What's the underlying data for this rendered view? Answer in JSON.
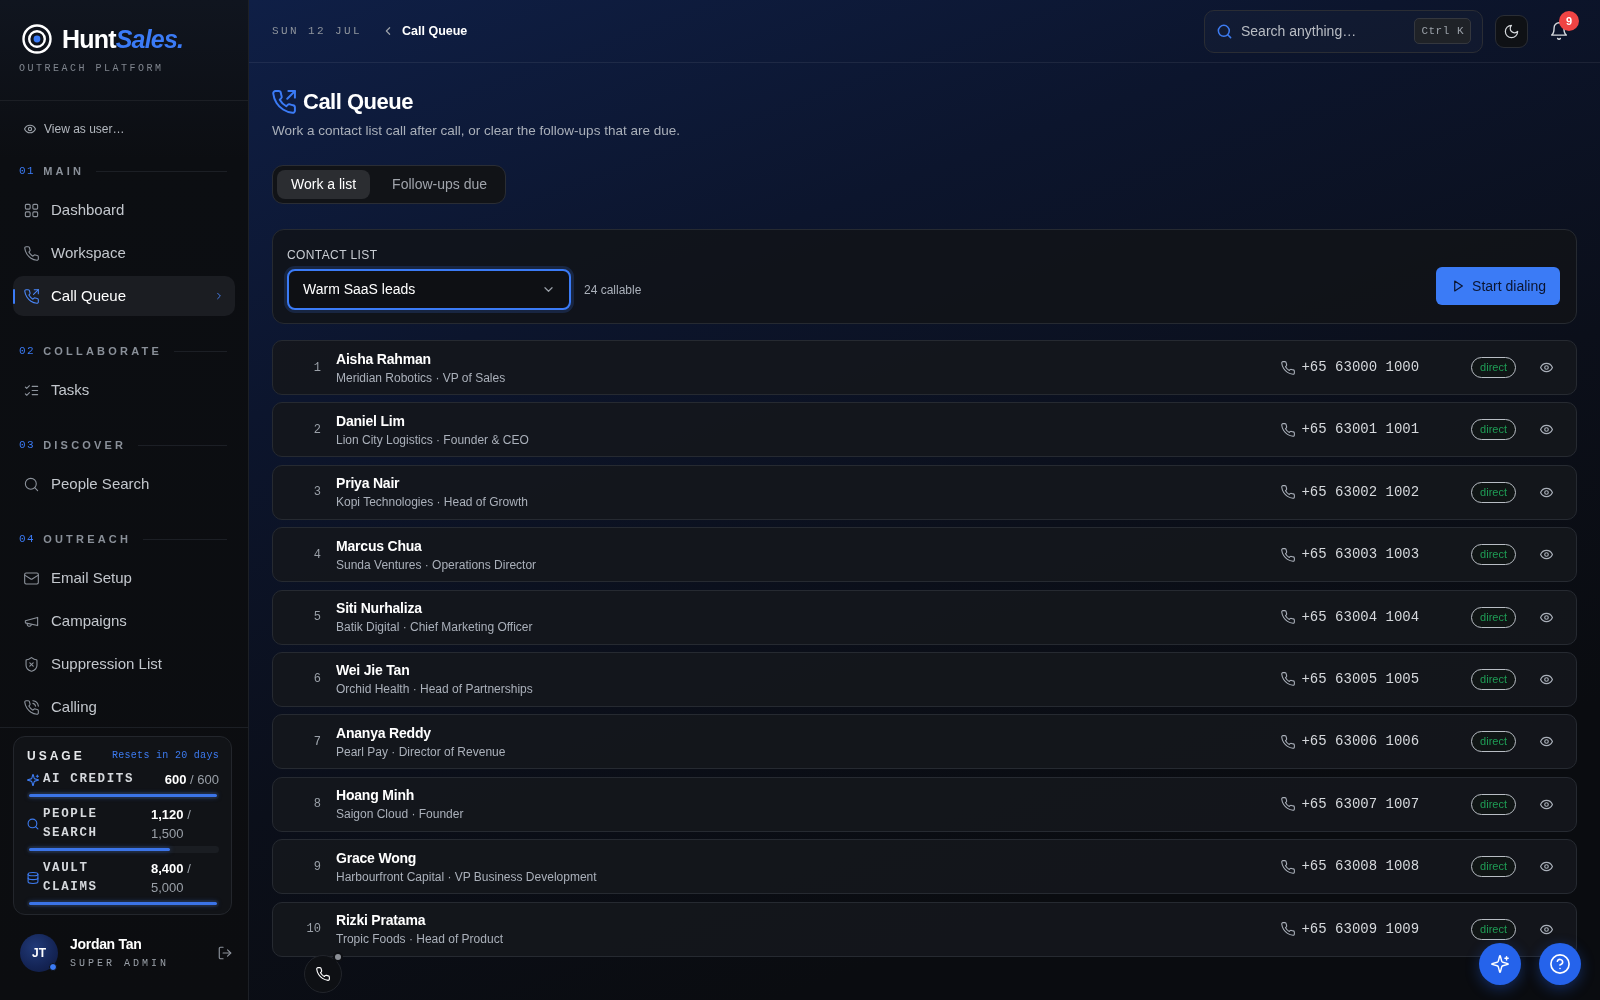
{
  "sidebar": {
    "brand": {
      "name": "Hunt",
      "accent": "Sales."
    },
    "tagline": "OUTREACH PLATFORM",
    "view_as": "View as user…",
    "sections": [
      {
        "number": "01",
        "title": "MAIN",
        "items": [
          {
            "label": "Dashboard",
            "selected": false
          },
          {
            "label": "Workspace",
            "selected": false
          },
          {
            "label": "Call Queue",
            "selected": true
          }
        ]
      },
      {
        "number": "02",
        "title": "COLLABORATE",
        "items": [
          {
            "label": "Tasks",
            "selected": false
          }
        ]
      },
      {
        "number": "03",
        "title": "DISCOVER",
        "items": [
          {
            "label": "People Search",
            "selected": false
          }
        ]
      },
      {
        "number": "04",
        "title": "OUTREACH",
        "items": [
          {
            "label": "Email Setup",
            "selected": false
          },
          {
            "label": "Campaigns",
            "selected": false
          },
          {
            "label": "Suppression List",
            "selected": false
          },
          {
            "label": "Calling",
            "selected": false
          }
        ]
      }
    ],
    "usage": {
      "title": "USAGE",
      "reset_note": "Resets in 20 days",
      "meters": [
        {
          "label": "AI CREDITS",
          "reading": "**600** / 600",
          "level": 1
        },
        {
          "label": "PEOPLE SEARCH",
          "reading": "**1,120** / 1,500",
          "level": 0.75
        },
        {
          "label": "VAULT CLAIMS",
          "reading": "**8,400** / 5,000",
          "level": 1
        }
      ]
    },
    "user": {
      "initials": "JT",
      "name": "Jordan Tan",
      "role": "SUPER ADMIN"
    }
  },
  "topbar": {
    "date": "SUN 12 JUL",
    "breadcrumb": "Call Queue",
    "search": {
      "placeholder": "Search anything…",
      "shortcut": "Ctrl K"
    },
    "notification_count": "9"
  },
  "page": {
    "title": "Call Queue",
    "subtitle": "Work a contact list call after call, or clear the follow-ups that are due.",
    "tabs": [
      {
        "label": "Work a list",
        "selected": true
      },
      {
        "label": "Follow-ups due",
        "selected": false
      }
    ]
  },
  "contact_list": {
    "label": "CONTACT LIST",
    "value": "Warm SaaS leads",
    "count": "24 callable",
    "action": "Start dialing"
  },
  "contacts": [
    {
      "number": "1",
      "name": "Aisha Rahman",
      "details": "Meridian Robotics · VP of Sales",
      "phone": "+65 63000 1000",
      "tag": "direct"
    },
    {
      "number": "2",
      "name": "Daniel Lim",
      "details": "Lion City Logistics · Founder & CEO",
      "phone": "+65 63001 1001",
      "tag": "direct"
    },
    {
      "number": "3",
      "name": "Priya Nair",
      "details": "Kopi Technologies · Head of Growth",
      "phone": "+65 63002 1002",
      "tag": "direct"
    },
    {
      "number": "4",
      "name": "Marcus Chua",
      "details": "Sunda Ventures · Operations Director",
      "phone": "+65 63003 1003",
      "tag": "direct"
    },
    {
      "number": "5",
      "name": "Siti Nurhaliza",
      "details": "Batik Digital · Chief Marketing Officer",
      "phone": "+65 63004 1004",
      "tag": "direct"
    },
    {
      "number": "6",
      "name": "Wei Jie Tan",
      "details": "Orchid Health · Head of Partnerships",
      "phone": "+65 63005 1005",
      "tag": "direct"
    },
    {
      "number": "7",
      "name": "Ananya Reddy",
      "details": "Pearl Pay · Director of Revenue",
      "phone": "+65 63006 1006",
      "tag": "direct"
    },
    {
      "number": "8",
      "name": "Hoang Minh",
      "details": "Saigon Cloud · Founder",
      "phone": "+65 63007 1007",
      "tag": "direct"
    },
    {
      "number": "9",
      "name": "Grace Wong",
      "details": "Harbourfront Capital · VP Business Development",
      "phone": "+65 63008 1008",
      "tag": "direct"
    },
    {
      "number": "10",
      "name": "Rizki Pratama",
      "details": "Tropic Foods · Head of Product",
      "phone": "+65 63009 1009",
      "tag": "direct"
    }
  ]
}
